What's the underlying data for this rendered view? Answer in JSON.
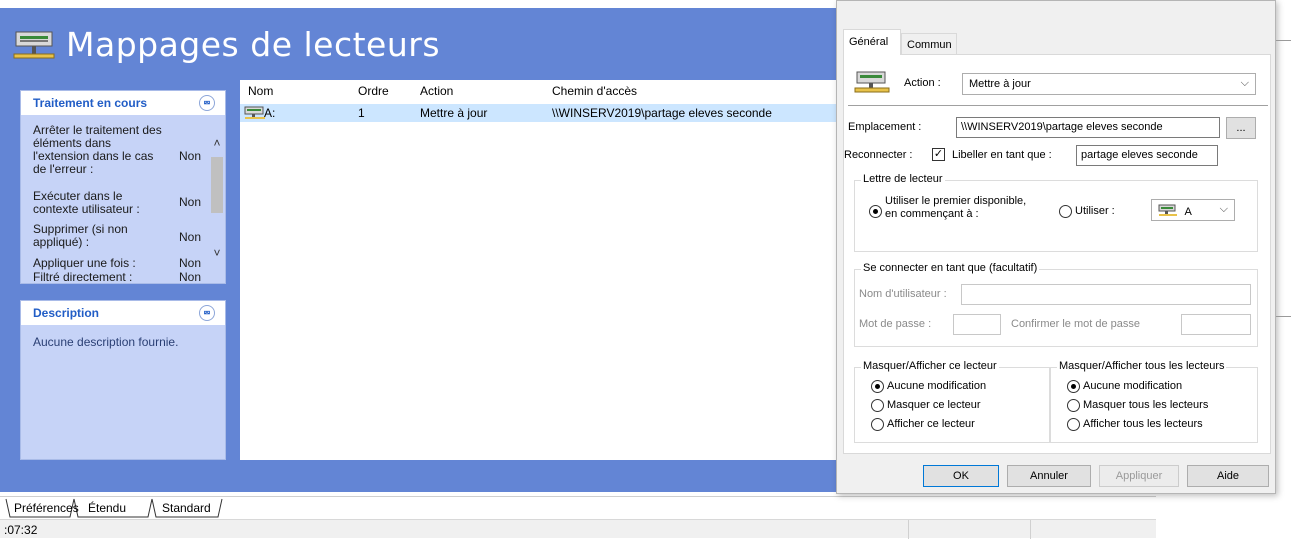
{
  "console": {
    "title": "Mappages de lecteurs",
    "task_panel": {
      "header": "Traitement en cours",
      "rows": [
        {
          "label": "Arrêter le traitement des éléments dans l'extension dans le cas de l'erreur :",
          "value": "Non"
        },
        {
          "label": "Exécuter dans le contexte utilisateur :",
          "value": "Non"
        },
        {
          "label": "Supprimer (si non appliqué) :",
          "value": "Non"
        },
        {
          "label": "Appliquer une fois :",
          "value": "Non"
        },
        {
          "label": "Filtré directement :",
          "value": "Non"
        }
      ]
    },
    "desc_panel": {
      "header": "Description",
      "text": "Aucune description fournie."
    },
    "list": {
      "columns": [
        "Nom",
        "Ordre",
        "Action",
        "Chemin d'accès"
      ],
      "rows": [
        {
          "name": "A:",
          "order": "1",
          "action": "Mettre à jour",
          "path": "\\\\WINSERV2019\\partage eleves seconde"
        }
      ]
    },
    "tabs": [
      "Préférences",
      "Étendu",
      "Standard"
    ],
    "status": {
      "time": ":07:32"
    }
  },
  "dialog": {
    "tabs": [
      "Général",
      "Commun"
    ],
    "action_label": "Action :",
    "action_value": "Mettre à jour",
    "location_label": "Emplacement :",
    "location_value": "\\\\WINSERV2019\\partage eleves seconde",
    "browse_label": "...",
    "reconnect_label": "Reconnecter :",
    "reconnect_checked": true,
    "label_as_label": "Libeller en tant que :",
    "label_as_value": "partage eleves seconde",
    "drive_group": {
      "title": "Lettre de lecteur",
      "first_available_line1": "Utiliser le premier disponible,",
      "first_available_line2": "en commençant à :",
      "use_label": "Utiliser :",
      "drive_value": "A"
    },
    "connect_group": {
      "title": "Se connecter en tant que (facultatif)",
      "username_label": "Nom d'utilisateur :",
      "password_label": "Mot de passe :",
      "confirm_label": "Confirmer le mot de passe"
    },
    "hide_this": {
      "title": "Masquer/Afficher ce lecteur",
      "options": [
        "Aucune modification",
        "Masquer ce lecteur",
        "Afficher ce lecteur"
      ]
    },
    "hide_all": {
      "title": "Masquer/Afficher tous les lecteurs",
      "options": [
        "Aucune modification",
        "Masquer tous les lecteurs",
        "Afficher tous les lecteurs"
      ]
    },
    "buttons": {
      "ok": "OK",
      "cancel": "Annuler",
      "apply": "Appliquer",
      "help": "Aide"
    }
  }
}
